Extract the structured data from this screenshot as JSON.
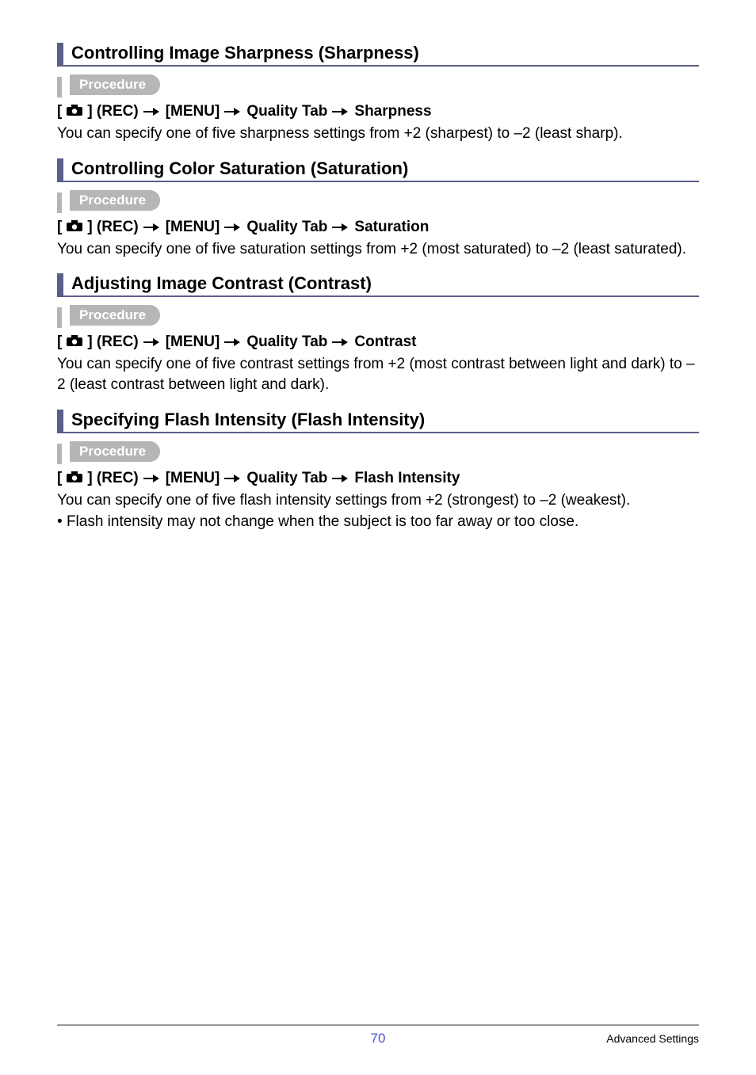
{
  "sections": [
    {
      "title": "Controlling Image Sharpness (Sharpness)",
      "proc": "Procedure",
      "rec": "] (REC)",
      "menu": "[MENU]",
      "qtab": "Quality Tab",
      "target": "Sharpness",
      "body": "You can specify one of five sharpness settings from +2 (sharpest) to –2 (least sharp).",
      "bullets": []
    },
    {
      "title": "Controlling Color Saturation (Saturation)",
      "proc": "Procedure",
      "rec": "] (REC)",
      "menu": "[MENU]",
      "qtab": "Quality Tab",
      "target": "Saturation",
      "body": "You can specify one of five saturation settings from +2 (most saturated) to –2 (least saturated).",
      "bullets": []
    },
    {
      "title": "Adjusting Image Contrast (Contrast)",
      "proc": "Procedure",
      "rec": "] (REC)",
      "menu": "[MENU]",
      "qtab": "Quality Tab",
      "target": "Contrast",
      "body": "You can specify one of five contrast settings from +2 (most contrast between light and dark) to –2 (least contrast between light and dark).",
      "bullets": []
    },
    {
      "title": "Specifying Flash Intensity (Flash Intensity)",
      "proc": "Procedure",
      "rec": "] (REC)",
      "menu": "[MENU]",
      "qtab": "Quality Tab",
      "target": "Flash Intensity",
      "body": "You can specify one of five flash intensity settings from +2 (strongest) to –2 (weakest).",
      "bullets": [
        "Flash intensity may not change when the subject is too far away or too close."
      ]
    }
  ],
  "footer": {
    "page": "70",
    "label": "Advanced Settings"
  },
  "bracket_open": "["
}
